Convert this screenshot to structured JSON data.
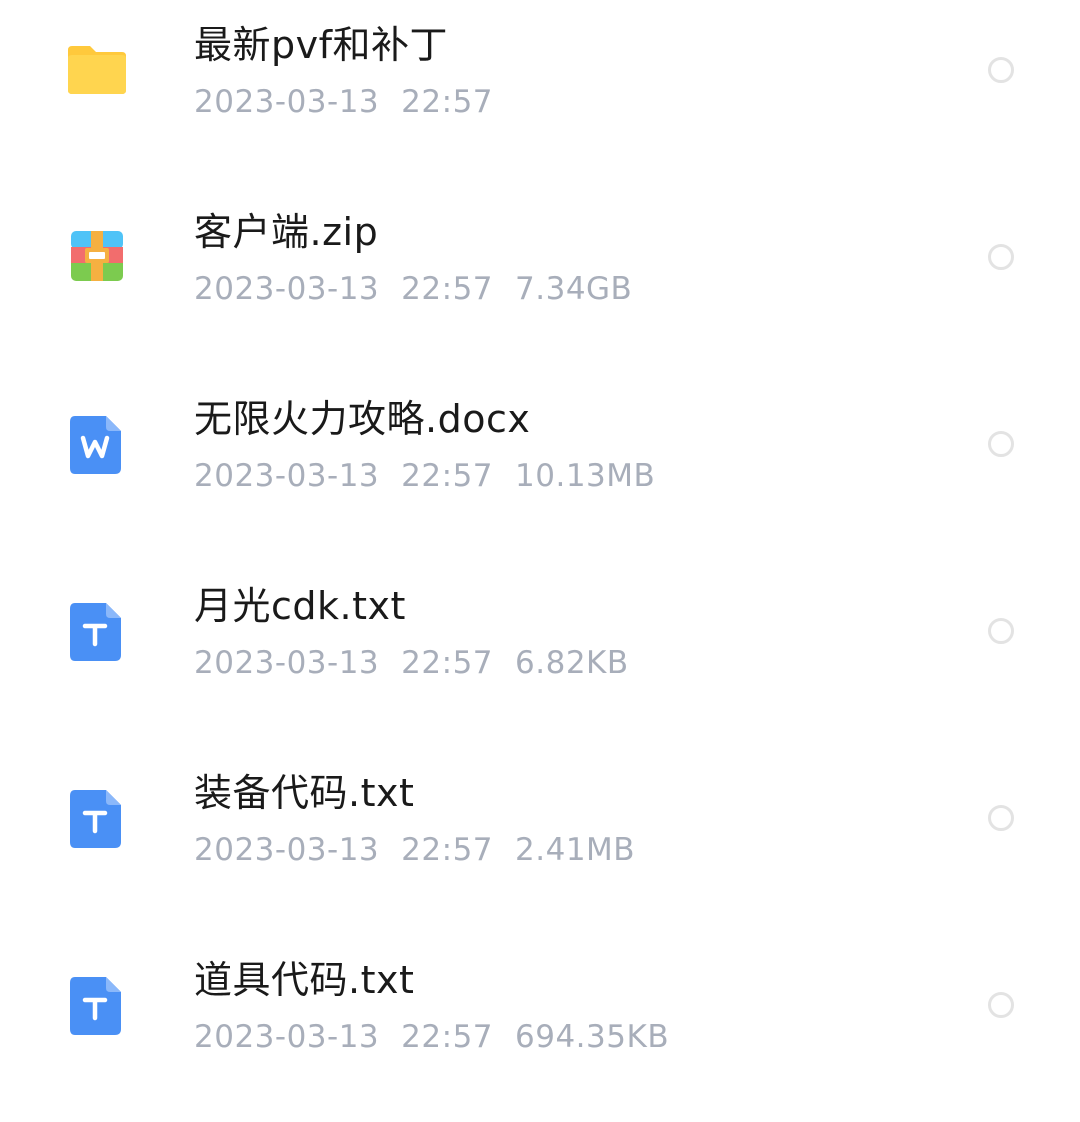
{
  "files": [
    {
      "name": "最新pvf和补丁",
      "date": "2023-03-13",
      "time": "22:57",
      "size": "",
      "icon": "folder-icon"
    },
    {
      "name": "客户端.zip",
      "date": "2023-03-13",
      "time": "22:57",
      "size": "7.34GB",
      "icon": "zip-archive-icon"
    },
    {
      "name": "无限火力攻略.docx",
      "date": "2023-03-13",
      "time": "22:57",
      "size": "10.13MB",
      "icon": "word-document-icon"
    },
    {
      "name": "月光cdk.txt",
      "date": "2023-03-13",
      "time": "22:57",
      "size": "6.82KB",
      "icon": "text-file-icon"
    },
    {
      "name": "装备代码.txt",
      "date": "2023-03-13",
      "time": "22:57",
      "size": "2.41MB",
      "icon": "text-file-icon"
    },
    {
      "name": "道具代码.txt",
      "date": "2023-03-13",
      "time": "22:57",
      "size": "694.35KB",
      "icon": "text-file-icon"
    }
  ],
  "colors": {
    "folder": "#FFD54F",
    "doc_blue": "#4A90F5",
    "zip_top": "#4FC3F7",
    "zip_mid": "#F26D6D",
    "zip_bottom": "#7CCB4F",
    "zip_band": "#F5B041"
  }
}
